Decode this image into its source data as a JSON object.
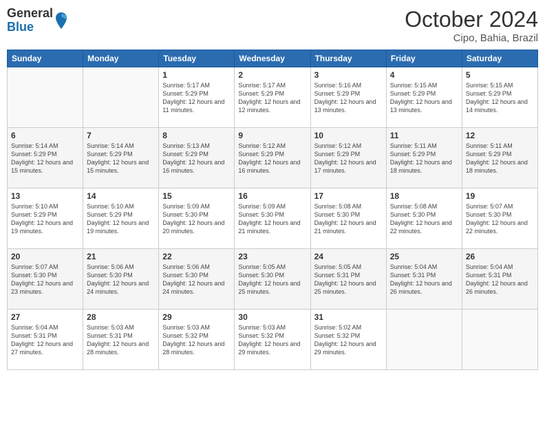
{
  "header": {
    "logo": {
      "general": "General",
      "blue": "Blue"
    },
    "title": "October 2024",
    "location": "Cipo, Bahia, Brazil"
  },
  "days_of_week": [
    "Sunday",
    "Monday",
    "Tuesday",
    "Wednesday",
    "Thursday",
    "Friday",
    "Saturday"
  ],
  "weeks": [
    [
      {
        "day": "",
        "sunrise": "",
        "sunset": "",
        "daylight": ""
      },
      {
        "day": "",
        "sunrise": "",
        "sunset": "",
        "daylight": ""
      },
      {
        "day": "1",
        "sunrise": "Sunrise: 5:17 AM",
        "sunset": "Sunset: 5:29 PM",
        "daylight": "Daylight: 12 hours and 11 minutes."
      },
      {
        "day": "2",
        "sunrise": "Sunrise: 5:17 AM",
        "sunset": "Sunset: 5:29 PM",
        "daylight": "Daylight: 12 hours and 12 minutes."
      },
      {
        "day": "3",
        "sunrise": "Sunrise: 5:16 AM",
        "sunset": "Sunset: 5:29 PM",
        "daylight": "Daylight: 12 hours and 13 minutes."
      },
      {
        "day": "4",
        "sunrise": "Sunrise: 5:15 AM",
        "sunset": "Sunset: 5:29 PM",
        "daylight": "Daylight: 12 hours and 13 minutes."
      },
      {
        "day": "5",
        "sunrise": "Sunrise: 5:15 AM",
        "sunset": "Sunset: 5:29 PM",
        "daylight": "Daylight: 12 hours and 14 minutes."
      }
    ],
    [
      {
        "day": "6",
        "sunrise": "Sunrise: 5:14 AM",
        "sunset": "Sunset: 5:29 PM",
        "daylight": "Daylight: 12 hours and 15 minutes."
      },
      {
        "day": "7",
        "sunrise": "Sunrise: 5:14 AM",
        "sunset": "Sunset: 5:29 PM",
        "daylight": "Daylight: 12 hours and 15 minutes."
      },
      {
        "day": "8",
        "sunrise": "Sunrise: 5:13 AM",
        "sunset": "Sunset: 5:29 PM",
        "daylight": "Daylight: 12 hours and 16 minutes."
      },
      {
        "day": "9",
        "sunrise": "Sunrise: 5:12 AM",
        "sunset": "Sunset: 5:29 PM",
        "daylight": "Daylight: 12 hours and 16 minutes."
      },
      {
        "day": "10",
        "sunrise": "Sunrise: 5:12 AM",
        "sunset": "Sunset: 5:29 PM",
        "daylight": "Daylight: 12 hours and 17 minutes."
      },
      {
        "day": "11",
        "sunrise": "Sunrise: 5:11 AM",
        "sunset": "Sunset: 5:29 PM",
        "daylight": "Daylight: 12 hours and 18 minutes."
      },
      {
        "day": "12",
        "sunrise": "Sunrise: 5:11 AM",
        "sunset": "Sunset: 5:29 PM",
        "daylight": "Daylight: 12 hours and 18 minutes."
      }
    ],
    [
      {
        "day": "13",
        "sunrise": "Sunrise: 5:10 AM",
        "sunset": "Sunset: 5:29 PM",
        "daylight": "Daylight: 12 hours and 19 minutes."
      },
      {
        "day": "14",
        "sunrise": "Sunrise: 5:10 AM",
        "sunset": "Sunset: 5:29 PM",
        "daylight": "Daylight: 12 hours and 19 minutes."
      },
      {
        "day": "15",
        "sunrise": "Sunrise: 5:09 AM",
        "sunset": "Sunset: 5:30 PM",
        "daylight": "Daylight: 12 hours and 20 minutes."
      },
      {
        "day": "16",
        "sunrise": "Sunrise: 5:09 AM",
        "sunset": "Sunset: 5:30 PM",
        "daylight": "Daylight: 12 hours and 21 minutes."
      },
      {
        "day": "17",
        "sunrise": "Sunrise: 5:08 AM",
        "sunset": "Sunset: 5:30 PM",
        "daylight": "Daylight: 12 hours and 21 minutes."
      },
      {
        "day": "18",
        "sunrise": "Sunrise: 5:08 AM",
        "sunset": "Sunset: 5:30 PM",
        "daylight": "Daylight: 12 hours and 22 minutes."
      },
      {
        "day": "19",
        "sunrise": "Sunrise: 5:07 AM",
        "sunset": "Sunset: 5:30 PM",
        "daylight": "Daylight: 12 hours and 22 minutes."
      }
    ],
    [
      {
        "day": "20",
        "sunrise": "Sunrise: 5:07 AM",
        "sunset": "Sunset: 5:30 PM",
        "daylight": "Daylight: 12 hours and 23 minutes."
      },
      {
        "day": "21",
        "sunrise": "Sunrise: 5:06 AM",
        "sunset": "Sunset: 5:30 PM",
        "daylight": "Daylight: 12 hours and 24 minutes."
      },
      {
        "day": "22",
        "sunrise": "Sunrise: 5:06 AM",
        "sunset": "Sunset: 5:30 PM",
        "daylight": "Daylight: 12 hours and 24 minutes."
      },
      {
        "day": "23",
        "sunrise": "Sunrise: 5:05 AM",
        "sunset": "Sunset: 5:30 PM",
        "daylight": "Daylight: 12 hours and 25 minutes."
      },
      {
        "day": "24",
        "sunrise": "Sunrise: 5:05 AM",
        "sunset": "Sunset: 5:31 PM",
        "daylight": "Daylight: 12 hours and 25 minutes."
      },
      {
        "day": "25",
        "sunrise": "Sunrise: 5:04 AM",
        "sunset": "Sunset: 5:31 PM",
        "daylight": "Daylight: 12 hours and 26 minutes."
      },
      {
        "day": "26",
        "sunrise": "Sunrise: 5:04 AM",
        "sunset": "Sunset: 5:31 PM",
        "daylight": "Daylight: 12 hours and 26 minutes."
      }
    ],
    [
      {
        "day": "27",
        "sunrise": "Sunrise: 5:04 AM",
        "sunset": "Sunset: 5:31 PM",
        "daylight": "Daylight: 12 hours and 27 minutes."
      },
      {
        "day": "28",
        "sunrise": "Sunrise: 5:03 AM",
        "sunset": "Sunset: 5:31 PM",
        "daylight": "Daylight: 12 hours and 28 minutes."
      },
      {
        "day": "29",
        "sunrise": "Sunrise: 5:03 AM",
        "sunset": "Sunset: 5:32 PM",
        "daylight": "Daylight: 12 hours and 28 minutes."
      },
      {
        "day": "30",
        "sunrise": "Sunrise: 5:03 AM",
        "sunset": "Sunset: 5:32 PM",
        "daylight": "Daylight: 12 hours and 29 minutes."
      },
      {
        "day": "31",
        "sunrise": "Sunrise: 5:02 AM",
        "sunset": "Sunset: 5:32 PM",
        "daylight": "Daylight: 12 hours and 29 minutes."
      },
      {
        "day": "",
        "sunrise": "",
        "sunset": "",
        "daylight": ""
      },
      {
        "day": "",
        "sunrise": "",
        "sunset": "",
        "daylight": ""
      }
    ]
  ]
}
